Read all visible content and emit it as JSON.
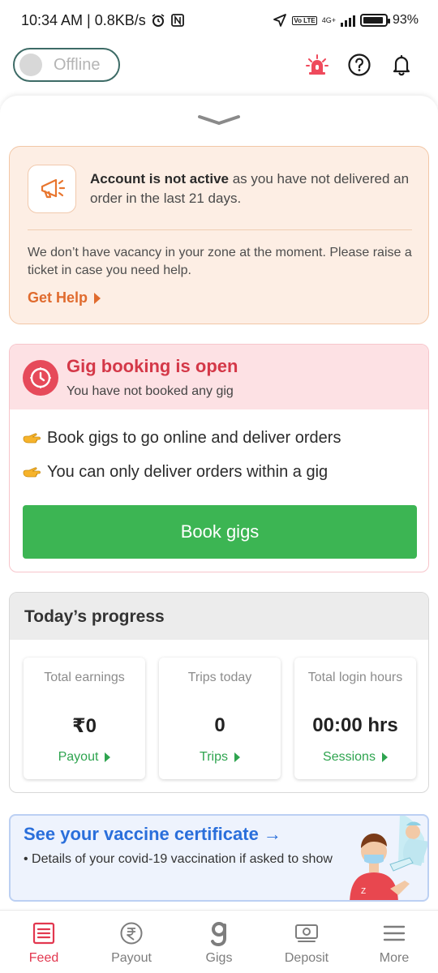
{
  "status_bar": {
    "time_speed": "10:34 AM | 0.8KB/s",
    "volte": "Vo LTE",
    "network": "4G+",
    "battery_text": "93%",
    "battery_level": 0.93
  },
  "app_bar": {
    "toggle_label": "Offline",
    "icons": [
      "siren-icon",
      "help-icon",
      "bell-icon"
    ]
  },
  "alert": {
    "headline_bold": "Account is not active",
    "headline_rest": " as you have not delivered an order in the last 21 days.",
    "body": "We don’t have vacancy in your zone at the moment. Please raise a ticket in case you need help.",
    "link": "Get Help"
  },
  "gig": {
    "title": "Gig booking is open",
    "subtitle": "You have not booked any gig",
    "points": [
      "Book gigs to go online and deliver orders",
      "You can only deliver orders within a gig"
    ],
    "button": "Book gigs"
  },
  "progress": {
    "title": "Today’s progress",
    "stats": [
      {
        "label": "Total earnings",
        "value": "₹0",
        "link": "Payout"
      },
      {
        "label": "Trips today",
        "value": "0",
        "link": "Trips"
      },
      {
        "label": "Total login hours",
        "value": "00:00 hrs",
        "link": "Sessions"
      }
    ]
  },
  "vaccine": {
    "title": "See your vaccine certificate →",
    "text": "• Details of your covid-19 vaccination if asked to show"
  },
  "nav": {
    "items": [
      {
        "label": "Feed",
        "icon": "feed-icon",
        "active": true
      },
      {
        "label": "Payout",
        "icon": "rupee-icon",
        "active": false
      },
      {
        "label": "Gigs",
        "icon": "gigs-icon",
        "active": false
      },
      {
        "label": "Deposit",
        "icon": "cash-icon",
        "active": false
      },
      {
        "label": "More",
        "icon": "menu-icon",
        "active": false
      }
    ]
  },
  "colors": {
    "accent_red": "#e2374f",
    "green": "#3cb553",
    "orange": "#e06b2e",
    "blue": "#2a6fdb"
  }
}
